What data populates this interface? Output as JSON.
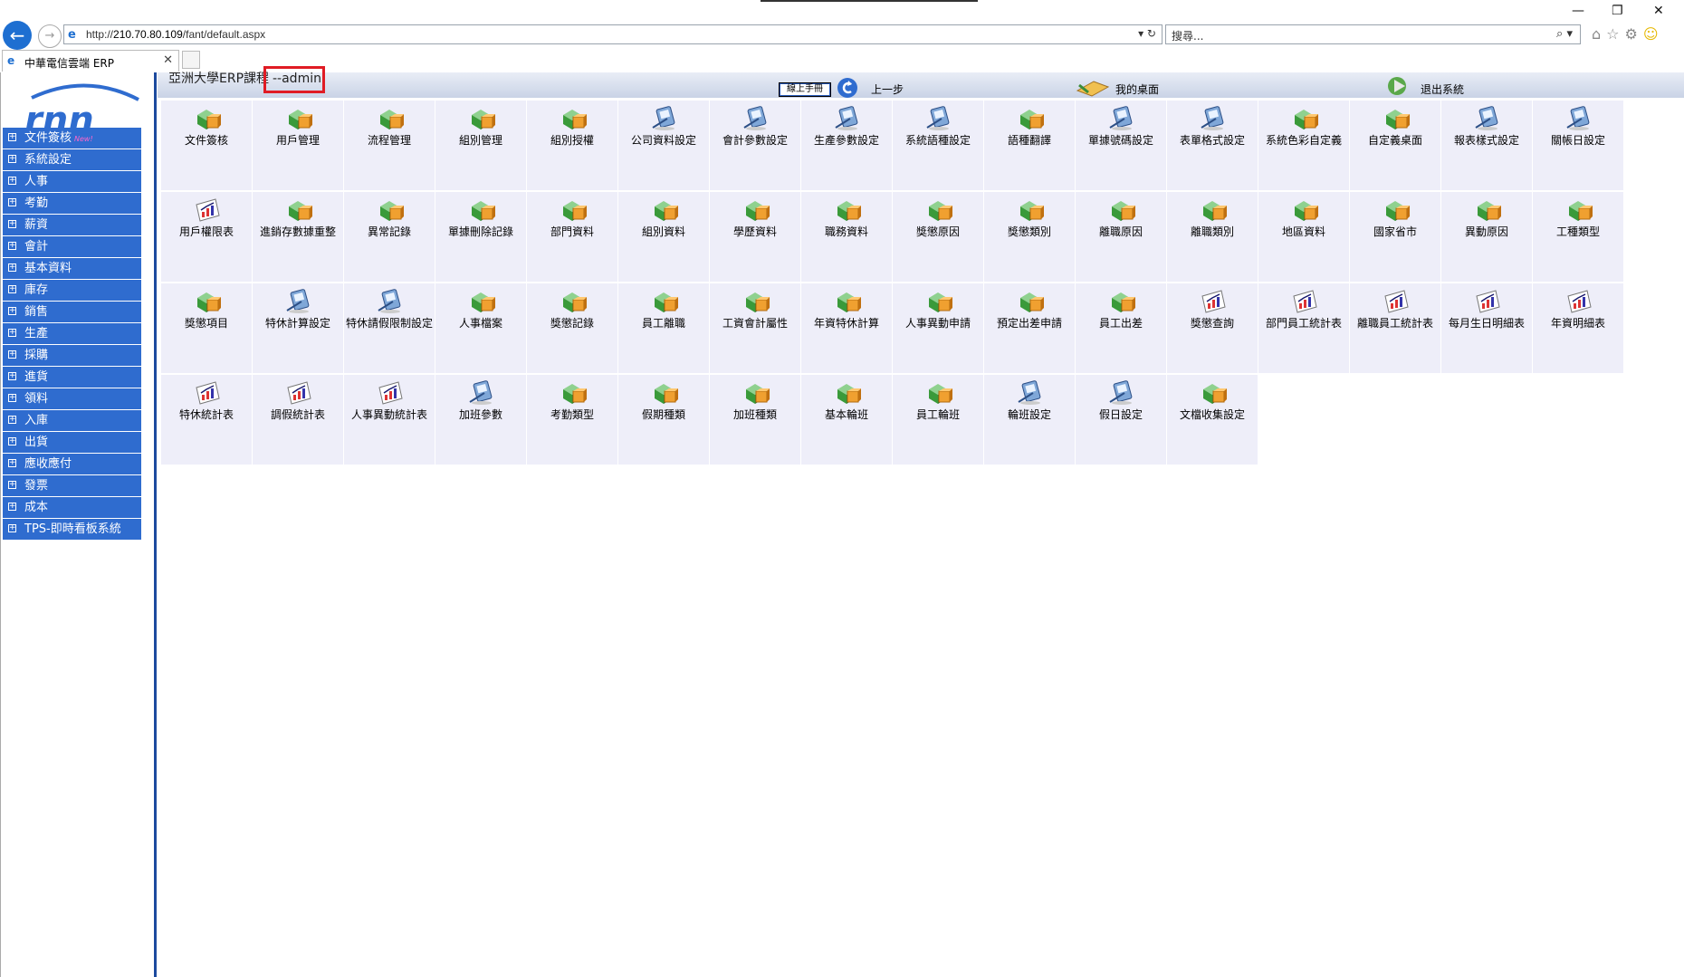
{
  "browser": {
    "url_prefix": "http://",
    "url_host": "210.70.80.109",
    "url_path": "/fant/default.aspx",
    "search_placeholder": "搜尋...",
    "tab_title": "中華電信雲端 ERP"
  },
  "header": {
    "course": "亞洲大學ERP課程",
    "user": "--admin",
    "manual_label": "線上手冊",
    "back_label": "上一步",
    "desktop_label": "我的桌面",
    "logout_label": "退出系統"
  },
  "sidebar": {
    "new_badge": "New!",
    "items": [
      "文件簽核",
      "系統設定",
      "人事",
      "考勤",
      "薪資",
      "會計",
      "基本資料",
      "庫存",
      "銷售",
      "生產",
      "採購",
      "進貨",
      "領料",
      "入庫",
      "出貨",
      "應收應付",
      "發票",
      "成本",
      "TPS-即時看板系統"
    ]
  },
  "functions": [
    {
      "label": "文件簽核",
      "icon": "box"
    },
    {
      "label": "用戶管理",
      "icon": "box"
    },
    {
      "label": "流程管理",
      "icon": "box"
    },
    {
      "label": "組別管理",
      "icon": "box"
    },
    {
      "label": "組別授權",
      "icon": "box"
    },
    {
      "label": "公司資料設定",
      "icon": "pda"
    },
    {
      "label": "會計參數設定",
      "icon": "pda"
    },
    {
      "label": "生產參數設定",
      "icon": "pda"
    },
    {
      "label": "系統語種設定",
      "icon": "pda"
    },
    {
      "label": "語種翻譯",
      "icon": "box"
    },
    {
      "label": "單據號碼設定",
      "icon": "pda"
    },
    {
      "label": "表單格式設定",
      "icon": "pda"
    },
    {
      "label": "系統色彩自定義",
      "icon": "box"
    },
    {
      "label": "自定義桌面",
      "icon": "box"
    },
    {
      "label": "報表樣式設定",
      "icon": "pda"
    },
    {
      "label": "關帳日設定",
      "icon": "pda"
    },
    {
      "label": "用戶權限表",
      "icon": "chart"
    },
    {
      "label": "進銷存數據重整",
      "icon": "box"
    },
    {
      "label": "異常記錄",
      "icon": "box"
    },
    {
      "label": "單據刪除記錄",
      "icon": "box"
    },
    {
      "label": "部門資料",
      "icon": "box"
    },
    {
      "label": "組別資料",
      "icon": "box"
    },
    {
      "label": "學歷資料",
      "icon": "box"
    },
    {
      "label": "職務資料",
      "icon": "box"
    },
    {
      "label": "獎懲原因",
      "icon": "box"
    },
    {
      "label": "獎懲類別",
      "icon": "box"
    },
    {
      "label": "離職原因",
      "icon": "box"
    },
    {
      "label": "離職類別",
      "icon": "box"
    },
    {
      "label": "地區資料",
      "icon": "box"
    },
    {
      "label": "國家省市",
      "icon": "box"
    },
    {
      "label": "異動原因",
      "icon": "box"
    },
    {
      "label": "工種類型",
      "icon": "box"
    },
    {
      "label": "獎懲項目",
      "icon": "box"
    },
    {
      "label": "特休計算設定",
      "icon": "pda"
    },
    {
      "label": "特休請假限制設定",
      "icon": "pda"
    },
    {
      "label": "人事檔案",
      "icon": "box"
    },
    {
      "label": "獎懲記錄",
      "icon": "box"
    },
    {
      "label": "員工離職",
      "icon": "box"
    },
    {
      "label": "工資會計屬性",
      "icon": "box"
    },
    {
      "label": "年資特休計算",
      "icon": "box"
    },
    {
      "label": "人事異動申請",
      "icon": "box"
    },
    {
      "label": "預定出差申請",
      "icon": "box"
    },
    {
      "label": "員工出差",
      "icon": "box"
    },
    {
      "label": "獎懲查詢",
      "icon": "chart"
    },
    {
      "label": "部門員工統計表",
      "icon": "chart"
    },
    {
      "label": "離職員工統計表",
      "icon": "chart"
    },
    {
      "label": "每月生日明細表",
      "icon": "chart"
    },
    {
      "label": "年資明細表",
      "icon": "chart"
    },
    {
      "label": "特休統計表",
      "icon": "chart"
    },
    {
      "label": "調假統計表",
      "icon": "chart"
    },
    {
      "label": "人事異動統計表",
      "icon": "chart"
    },
    {
      "label": "加班參數",
      "icon": "pda"
    },
    {
      "label": "考勤類型",
      "icon": "box"
    },
    {
      "label": "假期種類",
      "icon": "box"
    },
    {
      "label": "加班種類",
      "icon": "box"
    },
    {
      "label": "基本輪班",
      "icon": "box"
    },
    {
      "label": "員工輪班",
      "icon": "box"
    },
    {
      "label": "輪班設定",
      "icon": "pda"
    },
    {
      "label": "假日設定",
      "icon": "pda"
    },
    {
      "label": "文檔收集設定",
      "icon": "box"
    }
  ],
  "colors": {
    "menu_bg": "#2f6ccf",
    "cell_bg": "#eeeef9",
    "highlight": "#e01b24"
  }
}
